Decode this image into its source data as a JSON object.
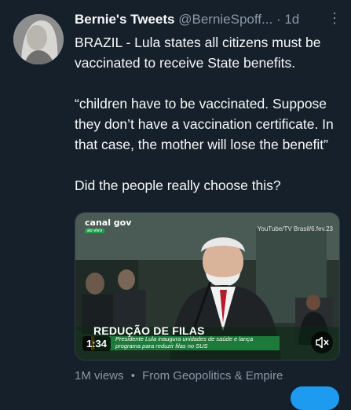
{
  "tweet": {
    "author_name": "Bernie's Tweets",
    "handle": "@BernieSpoff...",
    "separator": "·",
    "time": "1d",
    "more_icon": "more-icon",
    "paragraphs": [
      "BRAZIL - Lula states all citizens must be vaccinated to receive State benefits.",
      "“children have to be vaccinated. Suppose they don’t have a vaccination certificate. In that case, the mother will lose the benefit”",
      "Did the people really choose this?"
    ]
  },
  "media": {
    "logo": "canal gov",
    "logo_sub": "ao vivo",
    "credit": "YouTube/TV Brasil/6.fev.23",
    "headline": "REDUÇÃO DE FILAS",
    "subheadline": "Presidente Lula inaugura unidades de saúde e lança programa para reduzir filas no SUS",
    "duration": "1:34",
    "mute_icon": "volume-mute-icon"
  },
  "footer": {
    "views": "1M views",
    "separator": "•",
    "source": "From Geopolitics & Empire"
  },
  "colors": {
    "background": "#15202b",
    "text": "#f7f9f9",
    "muted": "#8b98a5",
    "accent": "#1d9bf0"
  }
}
